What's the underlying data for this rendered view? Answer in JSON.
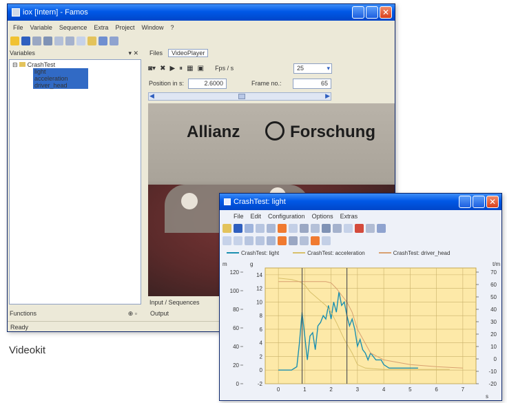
{
  "caption": "Videokit",
  "main_window": {
    "title": "iox [Intern] - Famos",
    "menu": [
      "File",
      "Variable",
      "Sequence",
      "Extra",
      "Project",
      "Window",
      "?"
    ],
    "variables_pane": {
      "header": "Variables",
      "tree": {
        "root": "CrashTest",
        "children": [
          "light",
          "acceleration",
          "driver_head"
        ]
      }
    },
    "tabs": [
      "Files",
      "VideoPlayer"
    ],
    "player": {
      "fps_label": "Fps / s",
      "fps_value": "25",
      "position_label": "Position in s:",
      "position_value": "2.6000",
      "frame_label": "Frame no.:",
      "frame_value": "65"
    },
    "video_text": "Allianz",
    "video_text2": "Forschung",
    "bottom_tabs": "Input / Sequences",
    "functions_label": "Functions",
    "output_label": "Output",
    "status": "Ready"
  },
  "chart_window": {
    "title": "CrashTest: light",
    "menu": [
      "File",
      "Edit",
      "Configuration",
      "Options",
      "Extras"
    ],
    "legend": [
      "CrashTest: light",
      "CrashTest: acceleration",
      "CrashTest: driver_head"
    ],
    "unit_left_outer": "m",
    "unit_left_inner": "g",
    "unit_right": "t/m"
  },
  "chart_data": {
    "type": "line",
    "x_ticks": [
      "0",
      "1",
      "2",
      "3",
      "4",
      "5",
      "6",
      "7"
    ],
    "y_outer_ticks": [
      "0",
      "20",
      "40",
      "60",
      "80",
      "100",
      "120"
    ],
    "y_inner_ticks": [
      "-2",
      "0",
      "2",
      "4",
      "6",
      "8",
      "10",
      "12",
      "14"
    ],
    "y_right_ticks": [
      "-20",
      "-10",
      "0",
      "10",
      "20",
      "30",
      "40",
      "50",
      "60",
      "70"
    ],
    "xlim": [
      -0.5,
      7.5
    ],
    "ylim": [
      -2,
      15
    ],
    "x_axis_label": "s",
    "grid": true,
    "series": [
      {
        "name": "CrashTest: light",
        "color": "#1a8fb0",
        "x": [
          0,
          0.5,
          0.7,
          0.8,
          0.9,
          1.0,
          1.1,
          1.2,
          1.3,
          1.4,
          1.5,
          1.6,
          1.7,
          1.8,
          1.9,
          2.0,
          2.1,
          2.2,
          2.3,
          2.4,
          2.5,
          2.6,
          2.7,
          2.8,
          2.9,
          3.0,
          3.1,
          3.2,
          3.3,
          3.4,
          3.5,
          3.7,
          3.9,
          4.0,
          4.2,
          4.5,
          5.0,
          5.3
        ],
        "y": [
          0,
          0,
          0.5,
          4,
          8.5,
          5,
          1.5,
          5,
          5.5,
          3,
          6.5,
          7,
          8,
          7.5,
          9.5,
          7.5,
          10,
          8.5,
          11.5,
          9.5,
          10,
          8,
          6.5,
          7.5,
          6,
          3.5,
          4.5,
          3,
          2.5,
          1.5,
          2.5,
          1.5,
          1.5,
          0.8,
          0.3,
          0.3,
          0.3,
          0.3
        ]
      },
      {
        "name": "CrashTest: acceleration",
        "color": "#d8c06a",
        "x": [
          0,
          0.5,
          0.8,
          1.0,
          1.2,
          1.5,
          1.8,
          2.0,
          2.2,
          2.5,
          2.8,
          3.0,
          3.3,
          3.6,
          4.0,
          4.5,
          5.0,
          5.5,
          6.0,
          6.5
        ],
        "y": [
          13.5,
          13.3,
          13.0,
          12.5,
          11.5,
          10.5,
          9.5,
          8.5,
          7,
          4.5,
          2.5,
          0.8,
          0.3,
          0.2,
          0.1,
          0.1,
          0.1,
          0.1,
          0.1,
          0.1
        ]
      },
      {
        "name": "CrashTest: driver_head",
        "color": "#d8a070",
        "x": [
          0,
          0.5,
          1.0,
          1.5,
          1.8,
          2.0,
          2.2,
          2.4,
          2.6,
          2.8,
          3.0,
          3.5,
          4.0,
          5.0,
          6.0,
          7.0
        ],
        "y": [
          13.0,
          13.0,
          13.0,
          13.0,
          13.0,
          12.8,
          12.0,
          11,
          10,
          8.5,
          6,
          2.5,
          1.5,
          0.8,
          0.5,
          0.3
        ]
      }
    ],
    "markers": [
      0.9,
      2.6
    ]
  }
}
